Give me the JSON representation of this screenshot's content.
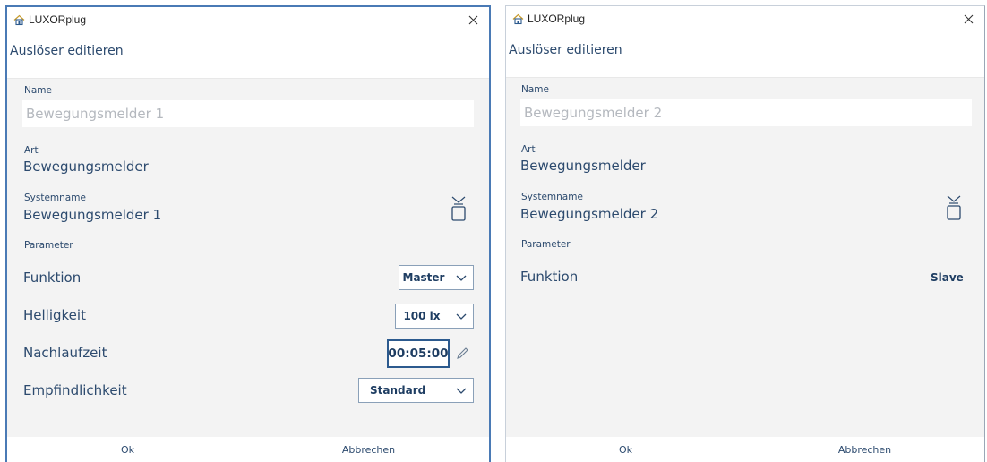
{
  "windows": [
    {
      "app_title": "LUXORplug",
      "dialog_title": "Auslöser editieren",
      "name_label": "Name",
      "name_placeholder": "Bewegungsmelder 1",
      "art_label": "Art",
      "art_value": "Bewegungsmelder",
      "systemname_label": "Systemname",
      "systemname_value": "Bewegungsmelder 1",
      "parameter_label": "Parameter",
      "funktion_label": "Funktion",
      "funktion_value": "Master",
      "helligkeit_label": "Helligkeit",
      "helligkeit_value": "100 lx",
      "nachlaufzeit_label": "Nachlaufzeit",
      "nachlaufzeit_value": "00:05:00",
      "empfindlichkeit_label": "Empfindlichkeit",
      "empfindlichkeit_value": "Standard",
      "ok_label": "Ok",
      "cancel_label": "Abbrechen"
    },
    {
      "app_title": "LUXORplug",
      "dialog_title": "Auslöser editieren",
      "name_label": "Name",
      "name_placeholder": "Bewegungsmelder 2",
      "art_label": "Art",
      "art_value": "Bewegungsmelder",
      "systemname_label": "Systemname",
      "systemname_value": "Bewegungsmelder 2",
      "parameter_label": "Parameter",
      "funktion_label": "Funktion",
      "funktion_value": "Slave",
      "ok_label": "Ok",
      "cancel_label": "Abbrechen"
    }
  ],
  "colors": {
    "accent": "#2c4a6e",
    "window_border": "#4a7ab5",
    "panel_bg": "#f3f3f3"
  },
  "icons": {
    "app": "home-icon",
    "close": "close-icon",
    "device": "remote-signal-icon",
    "dropdown": "chevron-down-icon",
    "edit": "pencil-icon"
  }
}
